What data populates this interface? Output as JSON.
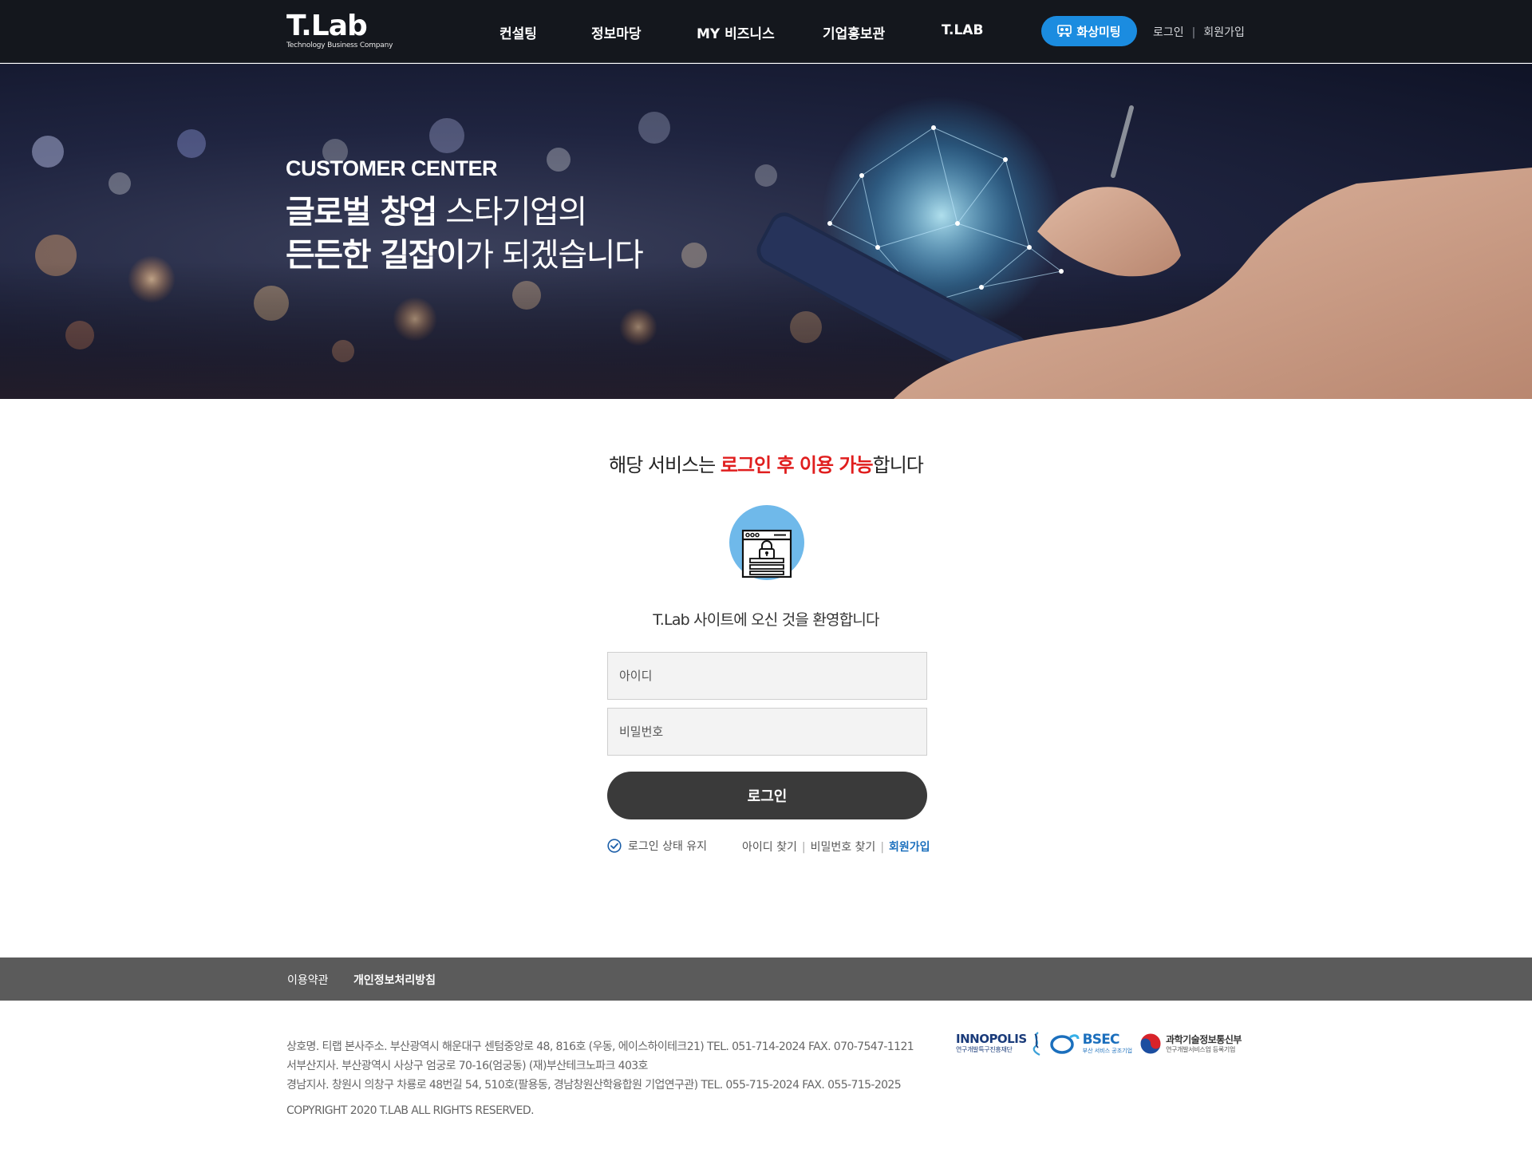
{
  "header": {
    "logo_text": "T.Lab",
    "logo_subtitle": "Technology Business Company",
    "nav": [
      "컨설팅",
      "정보마당",
      "MY 비즈니스",
      "기업홍보관",
      "T.LAB"
    ],
    "meeting_button": "화상미팅",
    "login_link": "로그인",
    "signup_link": "회원가입"
  },
  "hero": {
    "label": "CUSTOMER CENTER",
    "line1_bold": "글로벌 창업",
    "line1_rest": " 스타기업의",
    "line2_bold": "든든한 길잡이",
    "line2_rest": "가 되겠습니다"
  },
  "login": {
    "notice_prefix": "해당 서비스는 ",
    "notice_highlight": "로그인 후 이용 가능",
    "notice_suffix": "합니다",
    "welcome": "T.Lab 사이트에 오신 것을 환영합니다",
    "id_placeholder": "아이디",
    "pw_placeholder": "비밀번호",
    "login_button": "로그인",
    "keep_login": "로그인 상태 유지",
    "find_id": "아이디 찾기",
    "find_pw": "비밀번호 찾기",
    "join": "회원가입"
  },
  "footer": {
    "terms": "이용약관",
    "privacy": "개인정보처리방침",
    "line1": "상호명. 티랩   본사주소. 부산광역시 해운대구 센텀중앙로 48, 816호 (우동, 에이스하이테크21)   TEL. 051-714-2024   FAX. 070-7547-1121",
    "line2": "서부산지사. 부산광역시 사상구 엄궁로 70-16(엄궁동) (재)부산테크노파크 403호",
    "line3": "경남지사. 창원시 의창구 차룡로 48번길 54, 510호(팔용동, 경남창원산학융합원 기업연구관)   TEL. 055-715-2024   FAX. 055-715-2025",
    "copyright": "COPYRIGHT 2020 T.LAB ALL RIGHTS RESERVED.",
    "partners": {
      "innopolis_name": "INNOPOLIS",
      "innopolis_sub": "연구개발특구진흥재단",
      "bsec_name": "BSEC",
      "bsec_sub": "부산 서비스 공조기업",
      "msit_name": "과학기술정보통신부",
      "msit_sub": "연구개발서비스업 등록기업"
    }
  },
  "colors": {
    "accent_blue": "#1b8ce0",
    "highlight_red": "#e01e1e",
    "header_bg": "#14171d",
    "button_dark": "#3a3a3a",
    "footer_bar": "#5b5b5b"
  }
}
